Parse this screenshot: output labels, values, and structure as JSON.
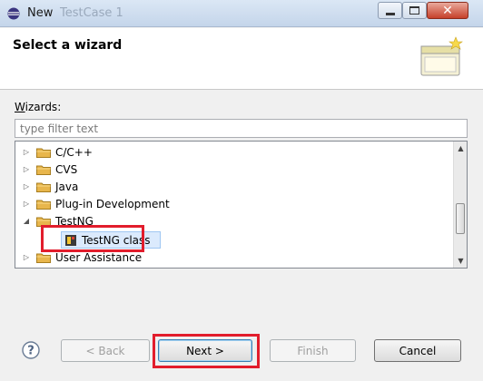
{
  "window": {
    "title": "New",
    "background_title": "TestCase 1"
  },
  "banner": {
    "title": "Select a wizard"
  },
  "wizards": {
    "label_prefix": "W",
    "label_rest": "izards:",
    "filter_placeholder": "type filter text"
  },
  "tree": {
    "items": [
      {
        "label": "C/C++",
        "expanded": false
      },
      {
        "label": "CVS",
        "expanded": false
      },
      {
        "label": "Java",
        "expanded": false
      },
      {
        "label": "Plug-in Development",
        "expanded": false
      },
      {
        "label": "TestNG",
        "expanded": true
      },
      {
        "label": "User Assistance",
        "expanded": false
      }
    ],
    "child": {
      "label": "TestNG class",
      "selected": true
    }
  },
  "buttons": {
    "back": "< Back",
    "next": "Next >",
    "finish": "Finish",
    "cancel": "Cancel"
  },
  "colors": {
    "highlight": "#e21d2c",
    "selection": "#dbeafd",
    "folder": "#e8b64c"
  }
}
